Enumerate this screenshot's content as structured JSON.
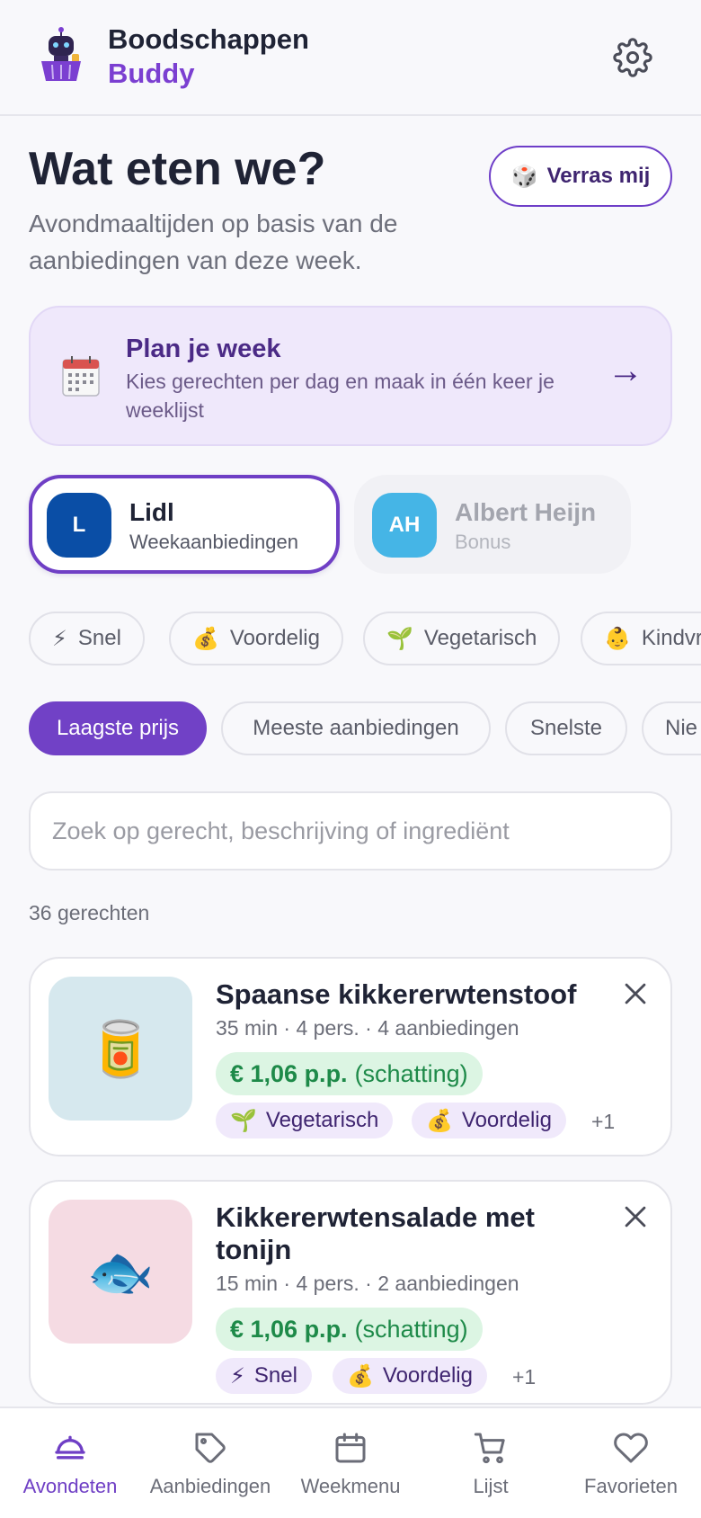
{
  "header": {
    "brand_line1": "Boodschappen",
    "brand_line2": "Buddy"
  },
  "hero": {
    "title": "Wat eten we?",
    "subtitle": "Avondmaaltijden op basis van de aanbiedingen van deze week.",
    "surprise_icon": "🎲",
    "surprise_label": "Verras mij"
  },
  "plan": {
    "icon": "🗓️",
    "title": "Plan je week",
    "description": "Kies gerechten per dag en maak in één keer je weeklijst",
    "arrow": "→"
  },
  "stores": [
    {
      "badge": "L",
      "name": "Lidl",
      "subtitle": "Weekaanbiedingen",
      "selected": true,
      "color": "#0a4ea6"
    },
    {
      "badge": "AH",
      "name": "Albert Heijn",
      "subtitle": "Bonus",
      "selected": false,
      "color": "#45b5e6"
    }
  ],
  "filters": [
    {
      "icon": "⚡",
      "label": "Snel"
    },
    {
      "icon": "💰",
      "label": "Voordelig"
    },
    {
      "icon": "🌱",
      "label": "Vegetarisch"
    },
    {
      "icon": "👶",
      "label": "Kindvr"
    }
  ],
  "sort_options": [
    {
      "label": "Laagste prijs",
      "active": true
    },
    {
      "label": "Meeste aanbiedingen",
      "active": false
    },
    {
      "label": "Snelste",
      "active": false
    },
    {
      "label": "Nie",
      "active": false
    }
  ],
  "search": {
    "placeholder": "Zoek op gerecht, beschrijving of ingrediënt"
  },
  "results_count": "36 gerechten",
  "recipes": [
    {
      "emoji": "🥫",
      "title": "Spaanse kikkererwtenstoof",
      "meta": "35 min · 4 pers. · 4 aanbiedingen",
      "price": "€ 1,06 p.p.",
      "price_note": "(schatting)",
      "tags": [
        {
          "icon": "🌱",
          "label": "Vegetarisch"
        },
        {
          "icon": "💰",
          "label": "Voordelig"
        }
      ],
      "more": "+1"
    },
    {
      "emoji": "🐟",
      "title": "Kikkererwtensalade met tonijn",
      "meta": "15 min · 4 pers. · 2 aanbiedingen",
      "price": "€ 1,06 p.p.",
      "price_note": "(schatting)",
      "tags": [
        {
          "icon": "⚡",
          "label": "Snel"
        },
        {
          "icon": "💰",
          "label": "Voordelig"
        }
      ],
      "more": "+1"
    }
  ],
  "tabs": [
    {
      "label": "Avondeten",
      "icon": "dinner-icon",
      "active": true
    },
    {
      "label": "Aanbiedingen",
      "icon": "tag-icon",
      "active": false
    },
    {
      "label": "Weekmenu",
      "icon": "calendar-icon",
      "active": false
    },
    {
      "label": "Lijst",
      "icon": "cart-icon",
      "active": false
    },
    {
      "label": "Favorieten",
      "icon": "heart-icon",
      "active": false
    }
  ],
  "colors": {
    "accent": "#7141c6",
    "lidl": "#0a4ea6",
    "ah": "#45b5e6",
    "price_green": "#1e8a49"
  }
}
